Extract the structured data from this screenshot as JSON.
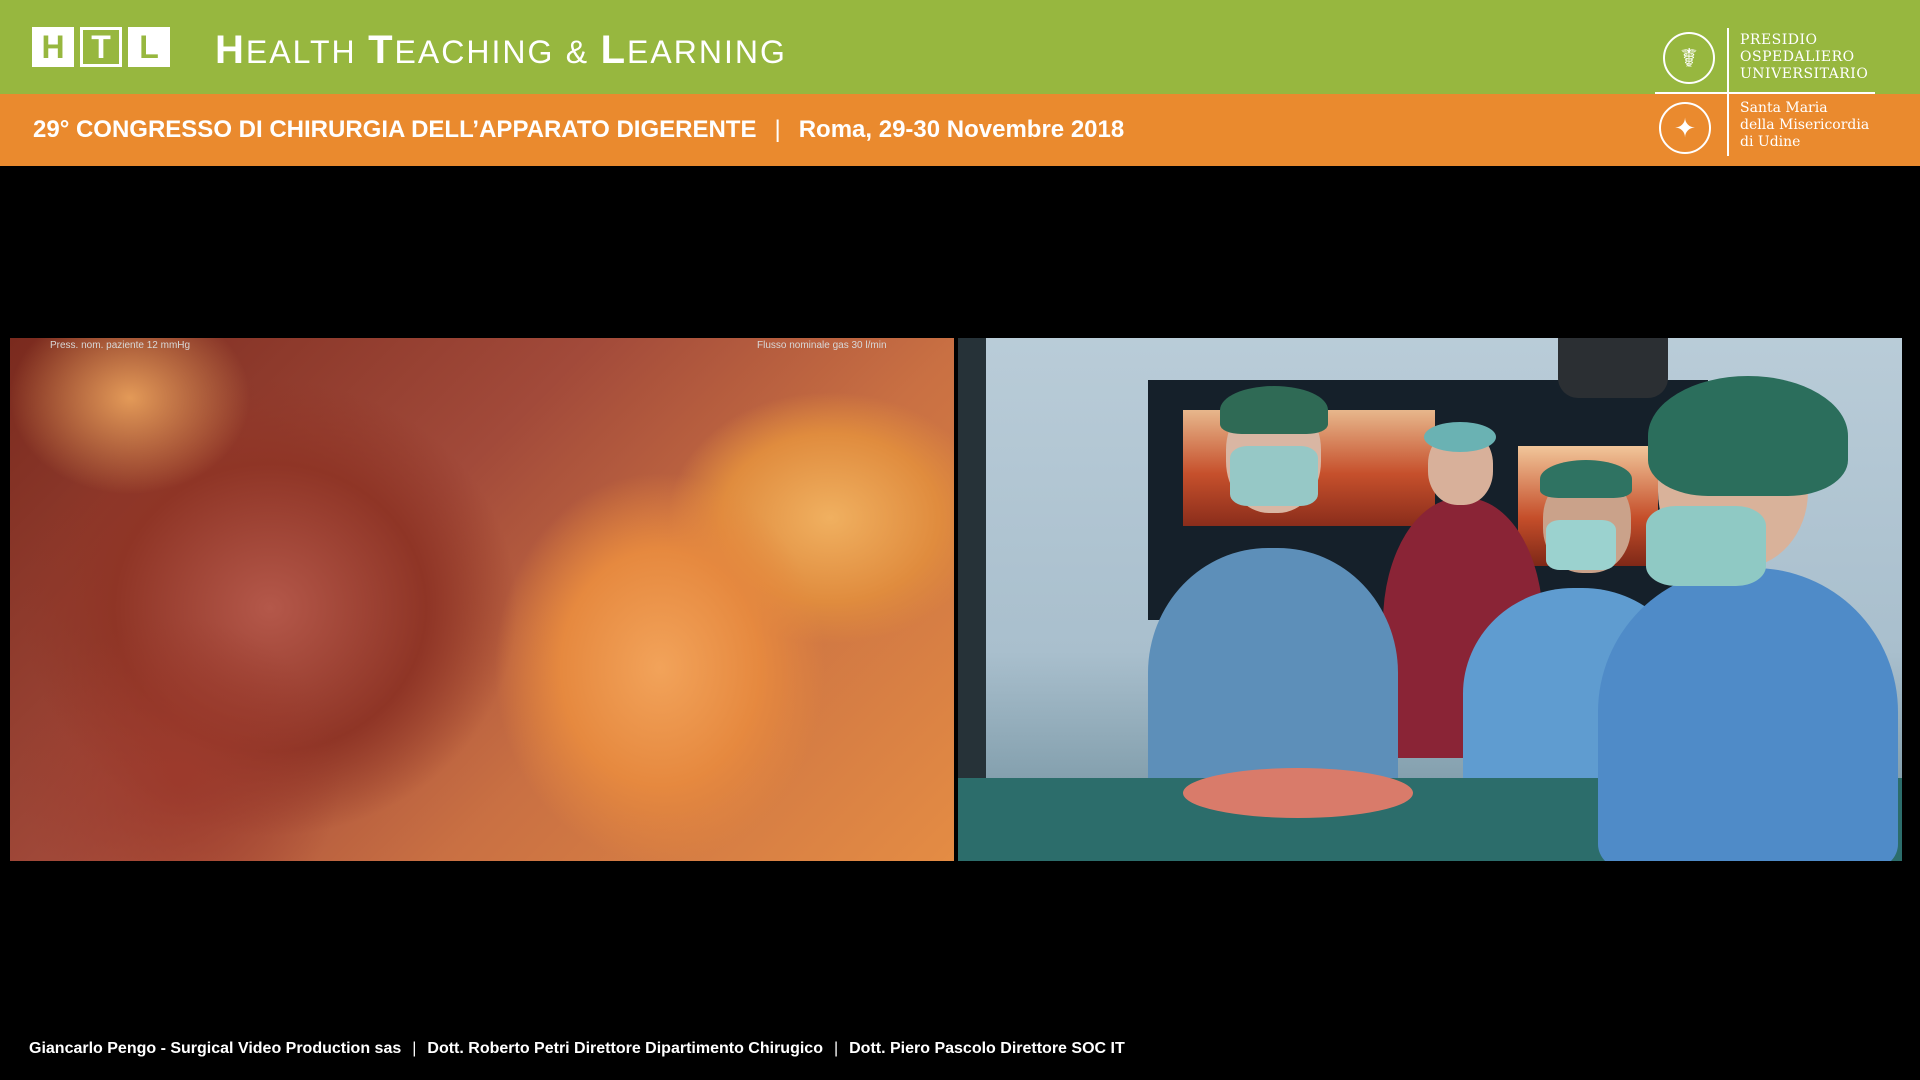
{
  "header": {
    "logo_letters": [
      "H",
      "T",
      "L"
    ],
    "brand": {
      "word1_cap": "H",
      "word1_rest": "EALTH",
      "word2_cap": "T",
      "word2_rest": "EACHING",
      "amp": "&",
      "word3_cap": "L",
      "word3_rest": "EARNING"
    },
    "colors": {
      "green": "#97b73f",
      "orange": "#ea8a2e"
    }
  },
  "conference": {
    "title": "29° CONGRESSO DI CHIRURGIA DELL’APPARATO DIGERENTE",
    "separator": "|",
    "location_date": "Roma, 29-30 Novembre 2018"
  },
  "hospital": {
    "name_top": "PRESIDIO\nOSPEDALIERO\nUNIVERSITARIO",
    "name_bottom": "Santa Maria\ndella Misericordia\ndi Udine"
  },
  "video": {
    "left_overlay_pressure": "Press. nom. paziente 12 mmHg",
    "left_overlay_flow": "Flusso nominale gas 30 l/min"
  },
  "footer": {
    "credits": [
      "Giancarlo Pengo - Surgical Video Production sas",
      "Dott. Roberto Petri Direttore Dipartimento Chirugico",
      "Dott. Piero Pascolo Direttore SOC IT"
    ],
    "separator": "|"
  }
}
